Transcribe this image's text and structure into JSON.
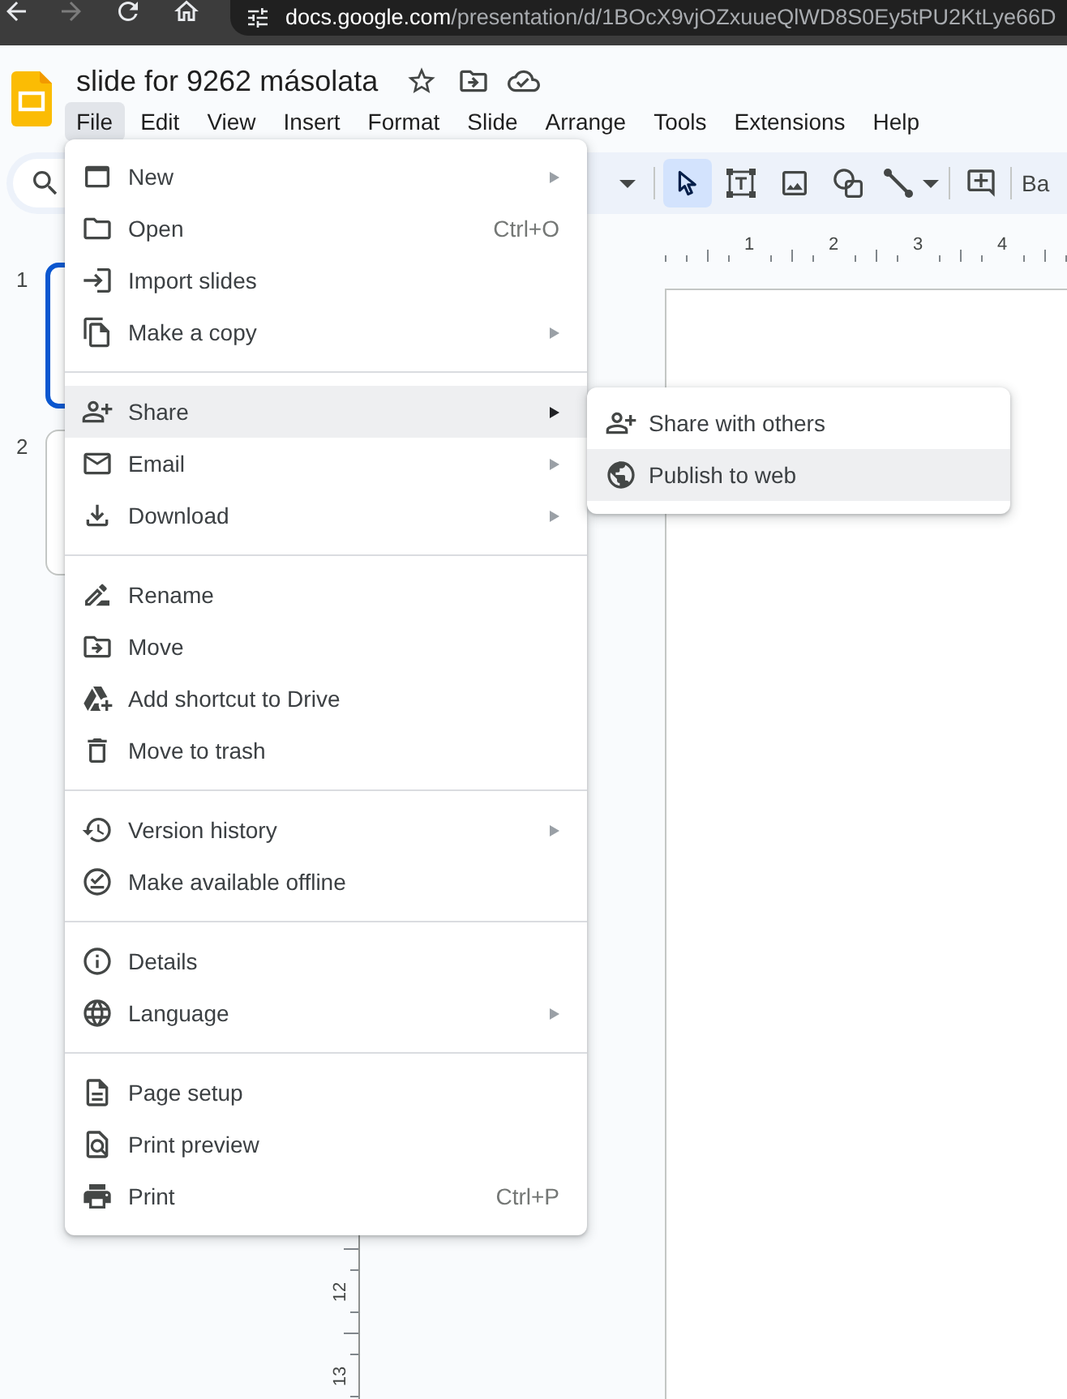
{
  "browser": {
    "back_disabled": false,
    "forward_disabled": true,
    "url_host": "docs.google.com",
    "url_path": "/presentation/d/1BOcX9vjOZxuueQlWD8S0Ey5tPU2KtLye66D"
  },
  "document": {
    "title": "slide for 9262 másolata"
  },
  "menu_bar": [
    {
      "label": "File",
      "selected": true
    },
    {
      "label": "Edit",
      "selected": false
    },
    {
      "label": "View",
      "selected": false
    },
    {
      "label": "Insert",
      "selected": false
    },
    {
      "label": "Format",
      "selected": false
    },
    {
      "label": "Slide",
      "selected": false
    },
    {
      "label": "Arrange",
      "selected": false
    },
    {
      "label": "Tools",
      "selected": false
    },
    {
      "label": "Extensions",
      "selected": false
    },
    {
      "label": "Help",
      "selected": false
    }
  ],
  "toolbar": {
    "tools": [
      {
        "kind": "pointer",
        "selected": true
      },
      {
        "kind": "text_box",
        "selected": false
      },
      {
        "kind": "image",
        "selected": false
      },
      {
        "kind": "shape",
        "selected": false
      },
      {
        "kind": "line",
        "selected": false
      }
    ],
    "background_button": "Ba"
  },
  "rulers": {
    "horizontal": [
      "1",
      "2",
      "3",
      "4"
    ],
    "vertical": [
      "12",
      "13"
    ]
  },
  "filmstrip": [
    {
      "number": "1",
      "selected": true
    },
    {
      "number": "2",
      "selected": false
    }
  ],
  "file_menu": {
    "sections": [
      {
        "items": [
          {
            "label": "New",
            "submenu": true,
            "selected": false
          },
          {
            "label": "Open",
            "shortcut": "Ctrl+O",
            "submenu": false,
            "selected": false
          },
          {
            "label": "Import slides",
            "submenu": false,
            "selected": false
          },
          {
            "label": "Make a copy",
            "submenu": true,
            "selected": false
          }
        ]
      },
      {
        "items": [
          {
            "label": "Share",
            "submenu": true,
            "selected": true
          },
          {
            "label": "Email",
            "submenu": true,
            "selected": false
          },
          {
            "label": "Download",
            "submenu": true,
            "selected": false
          }
        ]
      },
      {
        "items": [
          {
            "label": "Rename",
            "submenu": false,
            "selected": false
          },
          {
            "label": "Move",
            "submenu": false,
            "selected": false
          },
          {
            "label": "Add shortcut to Drive",
            "submenu": false,
            "selected": false
          },
          {
            "label": "Move to trash",
            "submenu": false,
            "selected": false
          }
        ]
      },
      {
        "items": [
          {
            "label": "Version history",
            "submenu": true,
            "selected": false
          },
          {
            "label": "Make available offline",
            "submenu": false,
            "selected": false
          }
        ]
      },
      {
        "items": [
          {
            "label": "Details",
            "submenu": false,
            "selected": false
          },
          {
            "label": "Language",
            "submenu": true,
            "selected": false
          }
        ]
      },
      {
        "items": [
          {
            "label": "Page setup",
            "submenu": false,
            "selected": false
          },
          {
            "label": "Print preview",
            "submenu": false,
            "selected": false
          },
          {
            "label": "Print",
            "shortcut": "Ctrl+P",
            "submenu": false,
            "selected": false
          }
        ]
      }
    ]
  },
  "share_submenu": {
    "items": [
      {
        "label": "Share with others",
        "selected": false
      },
      {
        "label": "Publish to web",
        "selected": true
      }
    ]
  }
}
